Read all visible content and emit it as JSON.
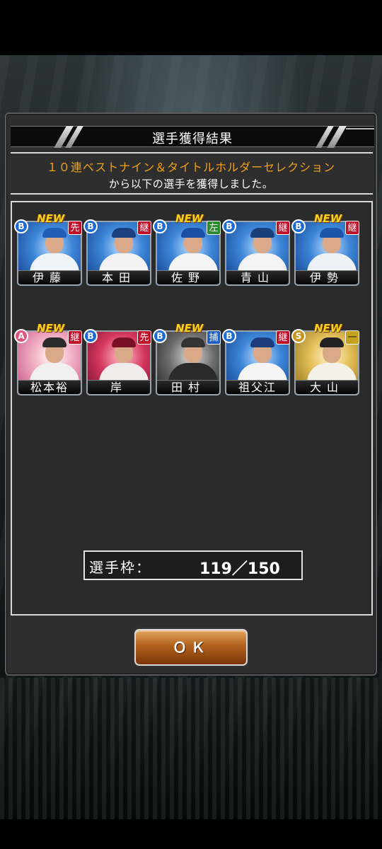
{
  "dialog": {
    "title": "選手獲得結果",
    "gacha_name": "１０連ベストナイン＆タイトルホルダーセレクション",
    "result_message": "から以下の選手を獲得しました。",
    "slot_label": "選手枠：",
    "slot_value": "119／150",
    "ok_label": "ＯＫ"
  },
  "new_tag_text": "NEW",
  "players": [
    {
      "name": "伊藤",
      "rank": "B",
      "position": "先",
      "is_new": true
    },
    {
      "name": "本田",
      "rank": "B",
      "position": "継",
      "is_new": false
    },
    {
      "name": "佐野",
      "rank": "B",
      "position": "左",
      "is_new": true
    },
    {
      "name": "青山",
      "rank": "B",
      "position": "継",
      "is_new": false
    },
    {
      "name": "伊勢",
      "rank": "B",
      "position": "継",
      "is_new": true
    },
    {
      "name": "松本裕",
      "rank": "A",
      "position": "継",
      "is_new": true
    },
    {
      "name": "岸",
      "rank": "B",
      "position": "先",
      "is_new": false
    },
    {
      "name": "田村",
      "rank": "B",
      "position": "捕",
      "is_new": true
    },
    {
      "name": "祖父江",
      "rank": "B",
      "position": "継",
      "is_new": false
    },
    {
      "name": "大山",
      "rank": "S",
      "position": "一",
      "is_new": true
    }
  ],
  "colors": {
    "accent_orange": "#f0a21a",
    "panel_bg": "#2e2e2e",
    "ok_button": "#b2621d"
  }
}
